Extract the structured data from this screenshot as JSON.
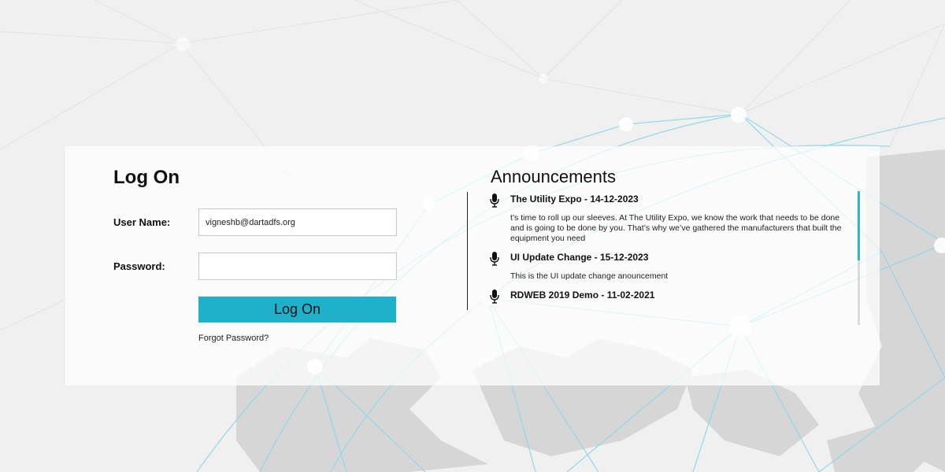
{
  "login": {
    "title": "Log On",
    "username_label": "User Name:",
    "username_value": "vigneshb@dartadfs.org",
    "password_label": "Password:",
    "password_value": "",
    "button_label": "Log On",
    "forgot_password": "Forgot Password?"
  },
  "announcements": {
    "title": "Announcements",
    "items": [
      {
        "heading": "The Utility Expo - 14-12-2023",
        "body": "t’s time to roll up our sleeves. At The Utility Expo, we know the work that needs to be done and is going to be done by you. That’s why we’ve gathered the manufacturers that built the equipment you need",
        "icon": "microphone-icon"
      },
      {
        "heading": "UI Update Change - 15-12-2023",
        "body": "This is the UI update change anouncement",
        "icon": "microphone-icon"
      },
      {
        "heading": "RDWEB 2019 Demo - 11-02-2021",
        "body": "",
        "icon": "microphone-icon"
      }
    ]
  },
  "colors": {
    "accent": "#1fb1cc",
    "background": "#f0f0f0",
    "network_lines": "#8fd9e6"
  },
  "scroll": {
    "position": 0
  }
}
